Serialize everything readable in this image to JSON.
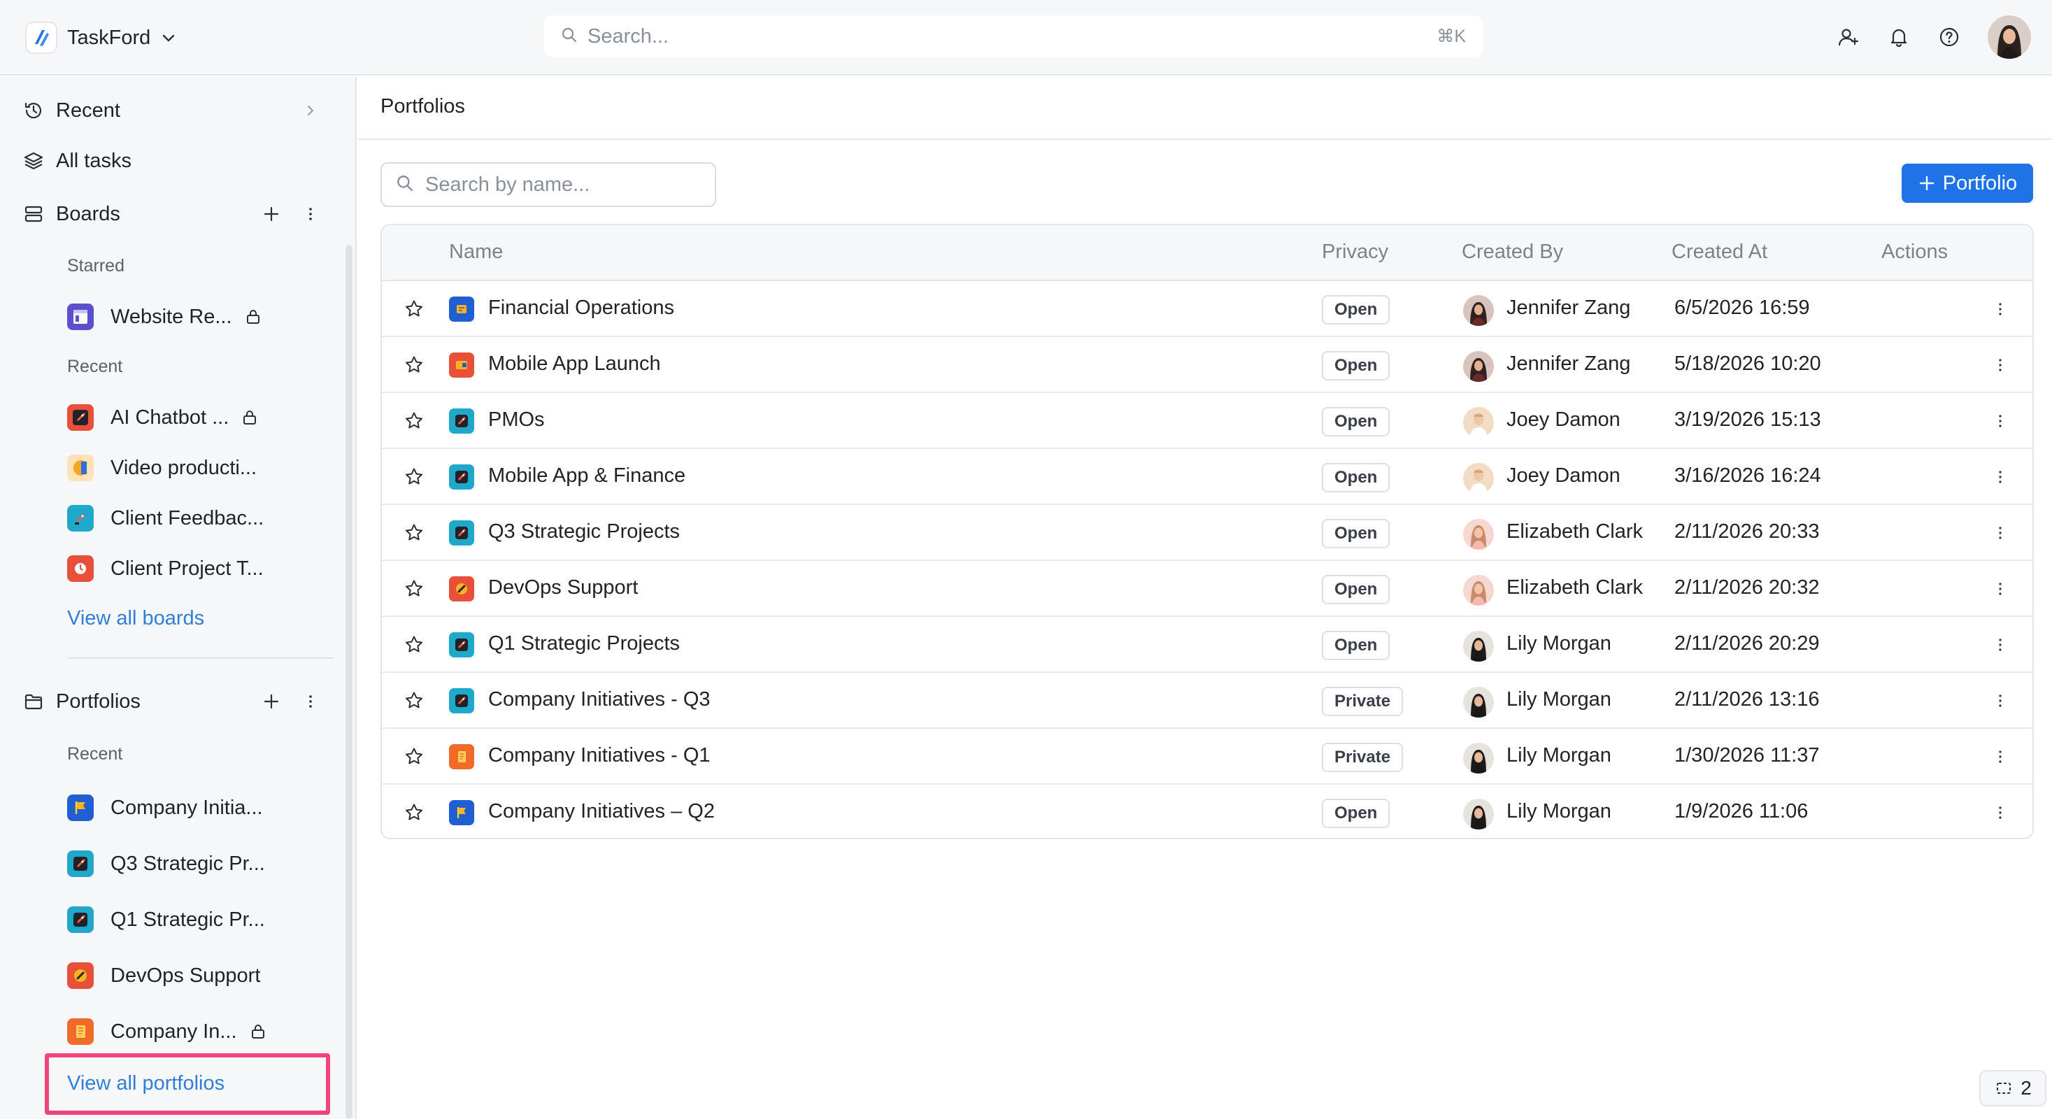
{
  "app": {
    "name": "TaskFord",
    "logo_icon": "taskford-logo-icon",
    "switcher_icon": "chevron-down-icon"
  },
  "topbar": {
    "search_placeholder": "Search...",
    "search_shortcut": "⌘K",
    "icons": [
      "invite-user-icon",
      "bell-icon",
      "help-icon"
    ],
    "avatar": "user-avatar"
  },
  "sidebar": {
    "nav": [
      {
        "label": "Recent",
        "icon": "history-icon",
        "action_icon": "chevron-right-icon"
      },
      {
        "label": "All tasks",
        "icon": "layers-icon"
      },
      {
        "label": "Boards",
        "icon": "boards-icon",
        "action_icons": [
          "plus-icon",
          "more-vertical-icon"
        ]
      }
    ],
    "boards": {
      "starred_label": "Starred",
      "starred": [
        {
          "label": "Website Re...",
          "icon": "board-app-icon",
          "locked": true
        }
      ],
      "recent_label": "Recent",
      "recent": [
        {
          "label": "AI Chatbot ...",
          "icon": "rocket-icon",
          "locked": true
        },
        {
          "label": "Video producti...",
          "icon": "pacman-icon",
          "locked": false
        },
        {
          "label": "Client Feedbac...",
          "icon": "rocket-icon",
          "locked": false
        },
        {
          "label": "Client Project T...",
          "icon": "clock-icon",
          "locked": false
        }
      ],
      "view_all": "View all boards"
    },
    "portfolios": {
      "label": "Portfolios",
      "icon": "folder-icon",
      "action_icons": [
        "plus-icon",
        "more-vertical-icon"
      ],
      "recent_label": "Recent",
      "recent": [
        {
          "label": "Company Initia...",
          "icon": "flag-icon",
          "locked": false
        },
        {
          "label": "Q3 Strategic Pr...",
          "icon": "rocket-icon",
          "locked": false
        },
        {
          "label": "Q1 Strategic Pr...",
          "icon": "rocket-icon",
          "locked": false
        },
        {
          "label": "DevOps Support",
          "icon": "wrench-icon",
          "locked": false
        },
        {
          "label": "Company In...",
          "icon": "notebook-icon",
          "locked": true
        }
      ],
      "view_all": "View all portfolios"
    }
  },
  "main": {
    "title": "Portfolios",
    "search_placeholder": "Search by name...",
    "add_button": "Portfolio",
    "columns": [
      "Name",
      "Privacy",
      "Created By",
      "Created At",
      "Actions"
    ],
    "rows": [
      {
        "name": "Financial Operations",
        "icon": "finance-icon",
        "privacy": "Open",
        "created_by": "Jennifer Zang",
        "created_at": "6/5/2026 16:59"
      },
      {
        "name": "Mobile App Launch",
        "icon": "mobile-app-icon",
        "privacy": "Open",
        "created_by": "Jennifer Zang",
        "created_at": "5/18/2026 10:20"
      },
      {
        "name": "PMOs",
        "icon": "rocket-icon",
        "privacy": "Open",
        "created_by": "Joey Damon",
        "created_at": "3/19/2026 15:13"
      },
      {
        "name": "Mobile App & Finance",
        "icon": "rocket-icon",
        "privacy": "Open",
        "created_by": "Joey Damon",
        "created_at": "3/16/2026 16:24"
      },
      {
        "name": "Q3 Strategic Projects",
        "icon": "rocket-icon",
        "privacy": "Open",
        "created_by": "Elizabeth Clark",
        "created_at": "2/11/2026 20:33"
      },
      {
        "name": "DevOps Support",
        "icon": "wrench-icon",
        "privacy": "Open",
        "created_by": "Elizabeth Clark",
        "created_at": "2/11/2026 20:32"
      },
      {
        "name": "Q1 Strategic Projects",
        "icon": "rocket-icon",
        "privacy": "Open",
        "created_by": "Lily Morgan",
        "created_at": "2/11/2026 20:29"
      },
      {
        "name": "Company Initiatives - Q3",
        "icon": "rocket-icon",
        "privacy": "Private",
        "created_by": "Lily Morgan",
        "created_at": "2/11/2026 13:16"
      },
      {
        "name": "Company Initiatives - Q1",
        "icon": "notebook-icon",
        "privacy": "Private",
        "created_by": "Lily Morgan",
        "created_at": "1/30/2026 11:37"
      },
      {
        "name": "Company Initiatives – Q2",
        "icon": "flag-icon",
        "privacy": "Open",
        "created_by": "Lily Morgan",
        "created_at": "1/9/2026 11:06"
      }
    ]
  },
  "corner_badge": {
    "count": "2",
    "icon": "selection-icon"
  },
  "colors": {
    "accent": "#1f73e6",
    "link": "#2f7fd6",
    "highlight": "#f0447a",
    "sidebar_bg": "#f6f7f8"
  }
}
